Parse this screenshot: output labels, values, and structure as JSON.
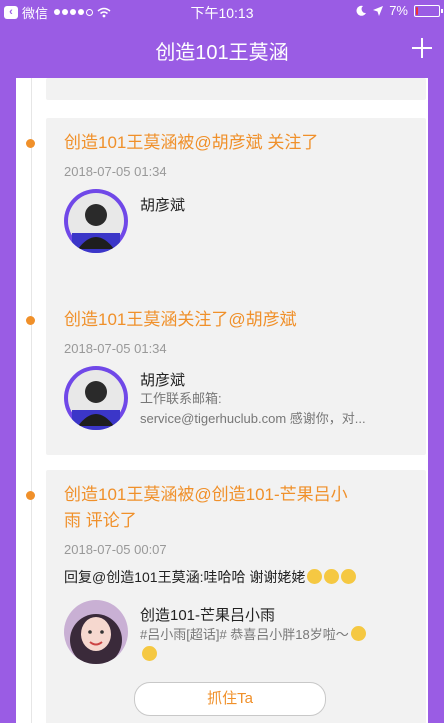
{
  "status_bar": {
    "back_label": "微信",
    "time": "下午10:13",
    "battery": "7%",
    "battery_level": 0.07
  },
  "nav": {
    "title": "创造101王莫涵",
    "add_icon": "plus-icon"
  },
  "feed": [
    {
      "title": "创造101王莫涵被@胡彦斌 关注了",
      "time": "2018-07-05 01:34",
      "user_name": "胡彦斌",
      "desc": ""
    },
    {
      "title": "创造101王莫涵关注了@胡彦斌",
      "time": "2018-07-05 01:34",
      "user_name": "胡彦斌",
      "desc_line1": "工作联系邮箱:",
      "desc_line2": "service@tigerhuclub.com 感谢你，对..."
    },
    {
      "title_line1": "创造101王莫涵被@创造101-芒果吕小",
      "title_line2": "雨 评论了",
      "time": "2018-07-05 00:07",
      "reply": "回复@创造101王莫涵:哇哈哈 谢谢姥姥",
      "user_name": "创造101-芒果吕小雨",
      "desc": "#吕小雨[超话]# 恭喜吕小胖18岁啦～",
      "button": "抓住Ta"
    }
  ],
  "colors": {
    "header": "#9a5ce4",
    "accent": "#f0902a",
    "card_bg": "#f2f2f2"
  }
}
